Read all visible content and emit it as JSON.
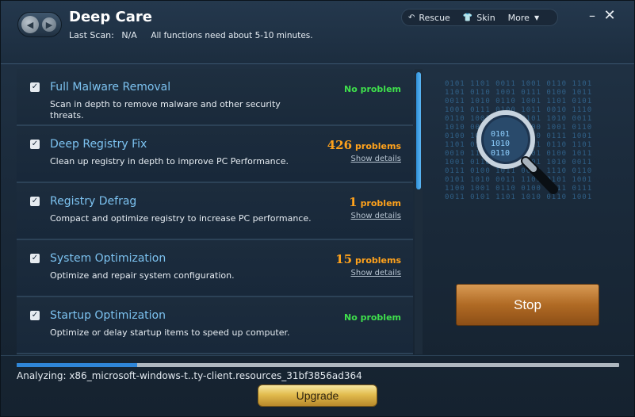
{
  "header": {
    "title": "Deep Care",
    "last_scan_label": "Last Scan:",
    "last_scan_value": "N/A",
    "note": "All functions need about 5-10 minutes.",
    "toolbar": {
      "rescue": "Rescue",
      "skin": "Skin",
      "more": "More"
    },
    "minimize": "–",
    "close": "✕"
  },
  "items": [
    {
      "title": "Full Malware Removal",
      "description": "Scan in depth to remove malware and other security threats.",
      "status_number": "",
      "status_text": "No problem",
      "status_type": "ok",
      "details": "",
      "checked": true
    },
    {
      "title": "Deep Registry Fix",
      "description": "Clean up registry in depth to improve PC Performance.",
      "status_number": "426",
      "status_text": "problems",
      "status_type": "warn",
      "details": "Show details",
      "checked": true
    },
    {
      "title": "Registry Defrag",
      "description": "Compact and optimize registry to increase PC performance.",
      "status_number": "1",
      "status_text": "problem",
      "status_type": "warn",
      "details": "Show details",
      "checked": true
    },
    {
      "title": "System Optimization",
      "description": "Optimize and repair system configuration.",
      "status_number": "15",
      "status_text": "problems",
      "status_type": "warn",
      "details": "Show details",
      "checked": true
    },
    {
      "title": "Startup Optimization",
      "description": "Optimize or delay startup items to speed up computer.",
      "status_number": "",
      "status_text": "No problem",
      "status_type": "ok",
      "details": "",
      "checked": true
    }
  ],
  "stop_label": "Stop",
  "progress": {
    "fraction": 0.2,
    "analyzing_text": "Analyzing: x86_microsoft-windows-t..ty-client.resources_31bf3856ad364"
  },
  "upgrade_label": "Upgrade",
  "colors": {
    "ok": "#3fe04c",
    "warn": "#ffa21c",
    "title": "#7cc2f0",
    "accent": "#2f86d8"
  },
  "icons": {
    "back": "chevron-left-icon",
    "forward": "chevron-right-icon",
    "rescue": "undo-arrow-icon",
    "skin": "shirt-icon",
    "more": "caret-down-icon",
    "checkbox": "checkmark-icon",
    "scan": "magnifier-icon"
  }
}
